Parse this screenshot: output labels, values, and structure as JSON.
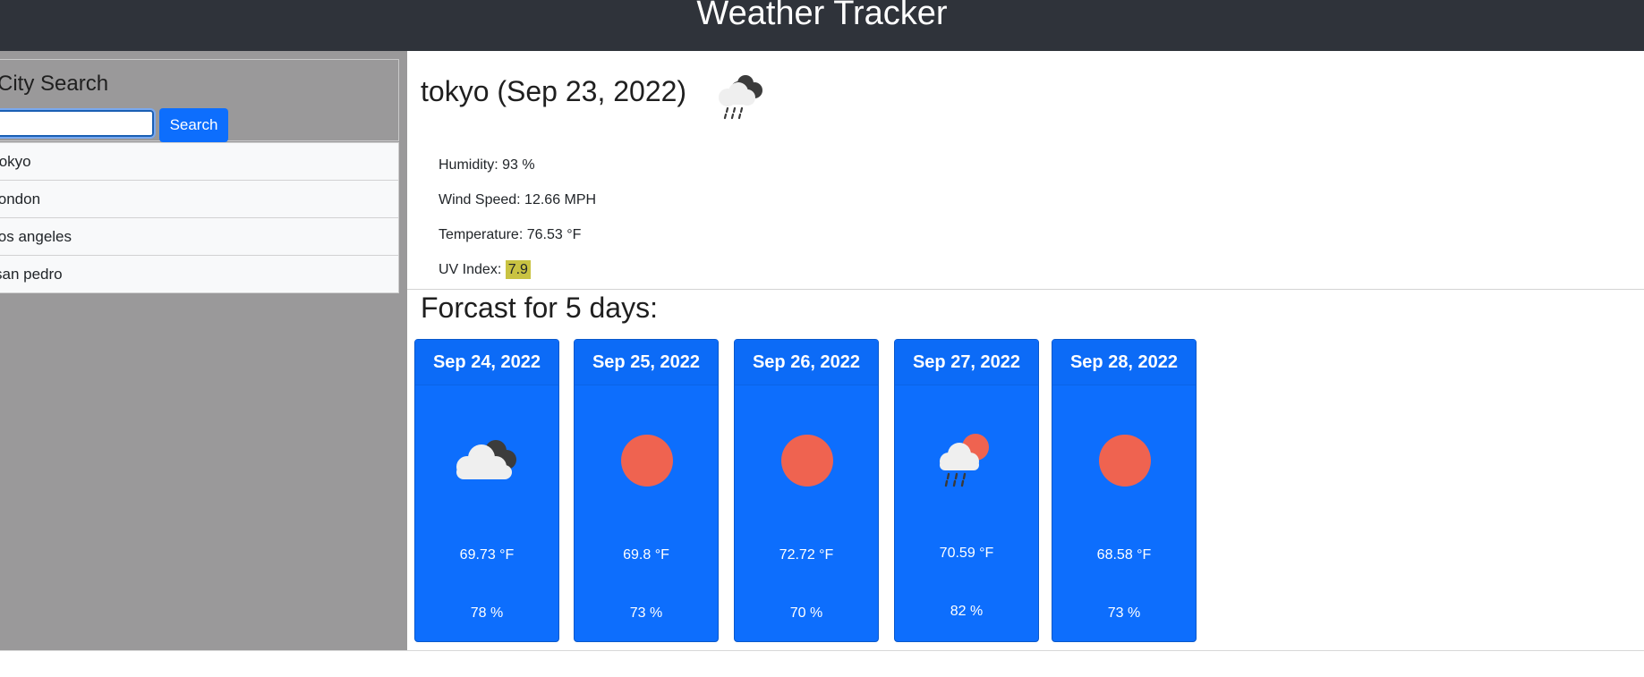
{
  "header": {
    "title": "Weather Tracker"
  },
  "sidebar": {
    "heading": "City Search",
    "search_button": "Search",
    "search_value": "",
    "history": [
      "tokyo",
      "london",
      "los angeles",
      "san pedro"
    ]
  },
  "current": {
    "title": "tokyo (Sep 23, 2022)",
    "icon": "rain-cloud-icon",
    "humidity": "Humidity: 93 %",
    "wind": "Wind Speed: 12.66 MPH",
    "temperature": "Temperature: 76.53 °F",
    "uv_label": "UV Index: ",
    "uv_value": "7.9",
    "uv_color": "#c9c342"
  },
  "forecast": {
    "title": "Forcast for 5 days:",
    "days": [
      {
        "date": "Sep 24, 2022",
        "icon": "cloudy-icon",
        "temp": "69.73 °F",
        "humidity": "78 %"
      },
      {
        "date": "Sep 25, 2022",
        "icon": "sun-icon",
        "temp": "69.8 °F",
        "humidity": "73 %"
      },
      {
        "date": "Sep 26, 2022",
        "icon": "sun-icon",
        "temp": "72.72 °F",
        "humidity": "70 %"
      },
      {
        "date": "Sep 27, 2022",
        "icon": "sun-rain-icon",
        "temp": "70.59 °F",
        "humidity": "82 %"
      },
      {
        "date": "Sep 28, 2022",
        "icon": "sun-icon",
        "temp": "68.58 °F",
        "humidity": "73 %"
      }
    ]
  },
  "colors": {
    "navbar": "#2f333a",
    "sidebar": "#9a999a",
    "primary": "#0d6efd",
    "sun": "#ef6350"
  }
}
